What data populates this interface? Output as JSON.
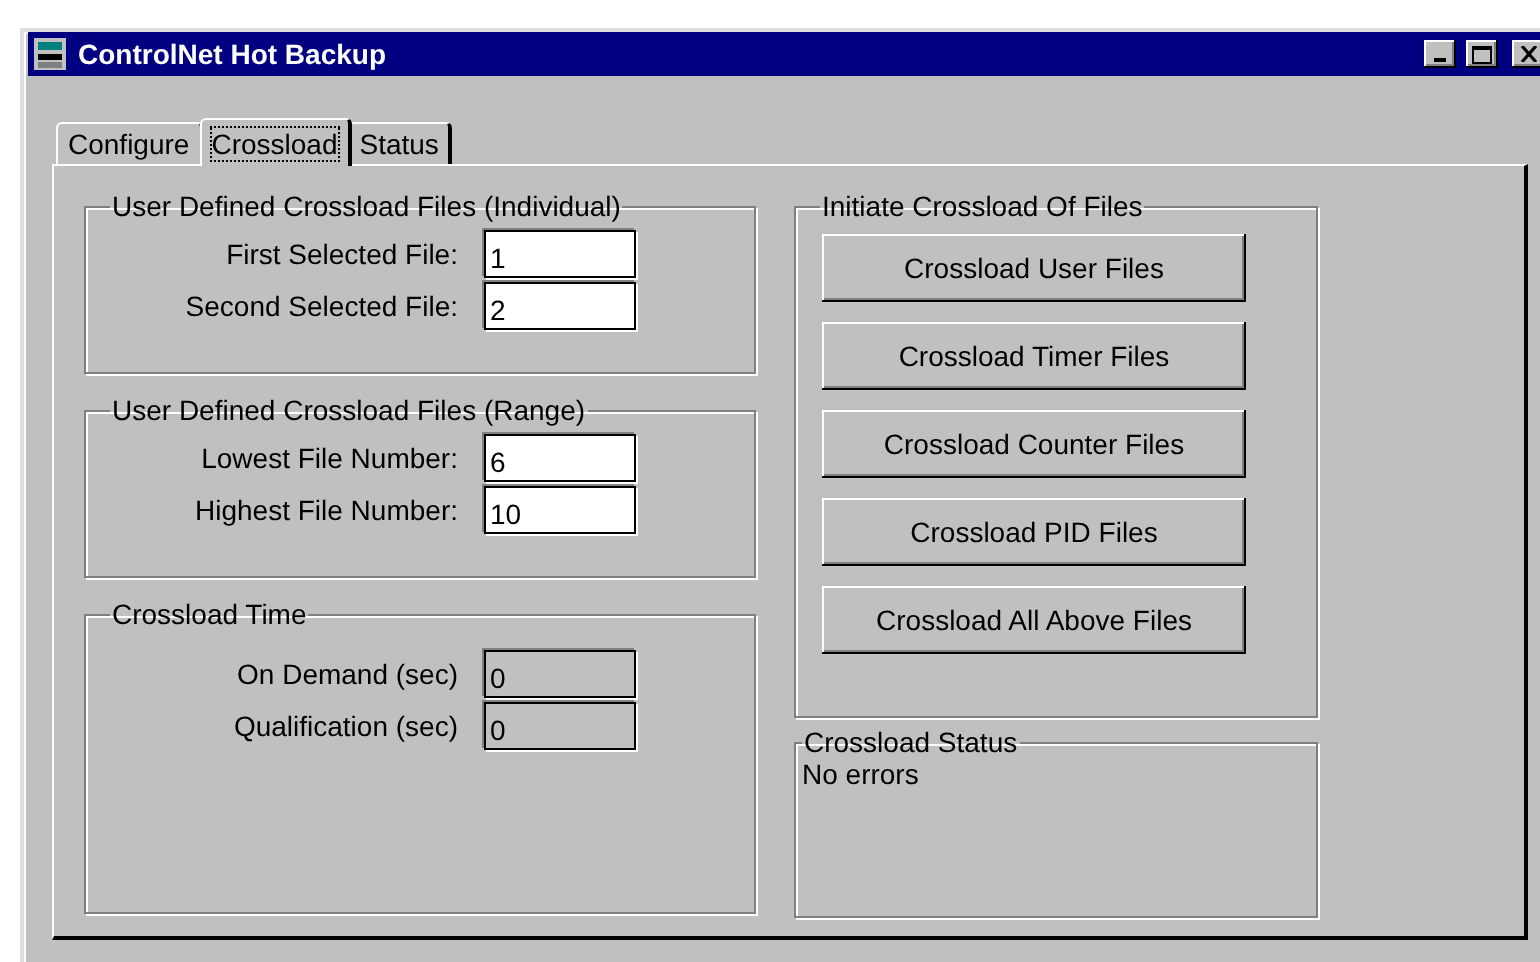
{
  "window": {
    "title": "ControlNet Hot Backup"
  },
  "tabs": [
    {
      "label": "Configure",
      "selected": false
    },
    {
      "label": "Crossload",
      "selected": true
    },
    {
      "label": "Status",
      "selected": false
    }
  ],
  "field_groups": [
    {
      "title": "User Defined Crossload Files (Individual)",
      "fields": [
        {
          "label": "First Selected File:",
          "value": "1",
          "disabled": false
        },
        {
          "label": "Second Selected File:",
          "value": "2",
          "disabled": false
        }
      ]
    },
    {
      "title": "User Defined Crossload Files (Range)",
      "fields": [
        {
          "label": "Lowest File Number:",
          "value": "6",
          "disabled": false
        },
        {
          "label": "Highest File Number:",
          "value": "10",
          "disabled": false
        }
      ]
    },
    {
      "title": "Crossload Time",
      "fields": [
        {
          "label": "On Demand (sec)",
          "value": "0",
          "disabled": true
        },
        {
          "label": "Qualification (sec)",
          "value": "0",
          "disabled": true
        }
      ]
    }
  ],
  "initiate": {
    "title": "Initiate Crossload Of Files",
    "buttons": [
      "Crossload User Files",
      "Crossload Timer Files",
      "Crossload Counter Files",
      "Crossload PID Files",
      "Crossload All Above Files"
    ]
  },
  "crossload_status": {
    "title": "Crossload Status",
    "message": "No errors"
  }
}
